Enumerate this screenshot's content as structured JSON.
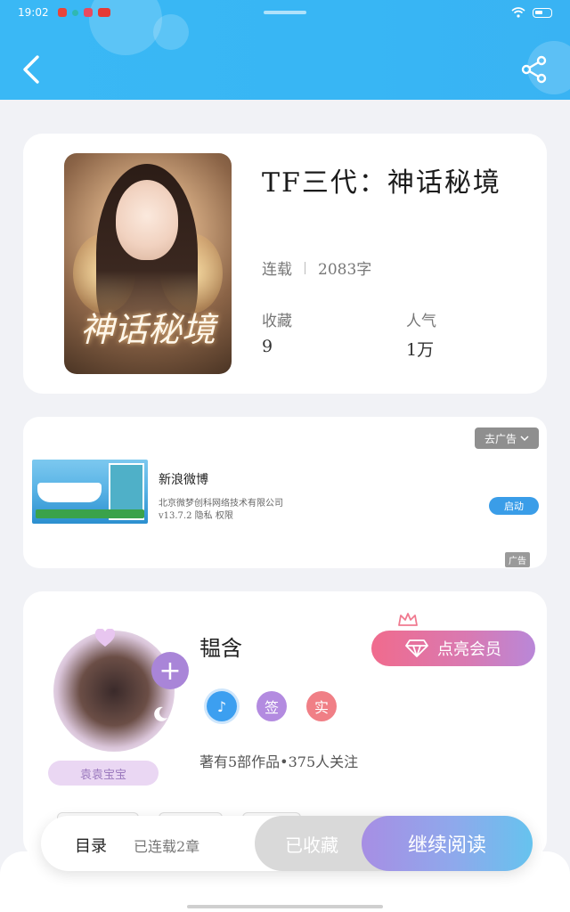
{
  "status_bar": {
    "time": "19:02"
  },
  "header": {
    "back_icon": "chevron-left-icon",
    "share_icon": "share-icon"
  },
  "book": {
    "title": "TF三代：神话秘境",
    "cover_title": "神话秘境",
    "status": "连载",
    "word_count": "2083字",
    "stats": [
      {
        "label": "收藏",
        "value": "9"
      },
      {
        "label": "人气",
        "value": "1万"
      }
    ]
  },
  "ad": {
    "close_label": "去广告",
    "app_name": "新浪微博",
    "company": "北京微梦创科网络技术有限公司",
    "version": "v13.7.2  隐私  权限",
    "cta": "启动",
    "tag": "广告"
  },
  "author": {
    "name": "韫含",
    "badge_text": "袁袁宝宝",
    "vip_label": "点亮会员",
    "badges": [
      {
        "label": "♪",
        "color": "#3c9ff0"
      },
      {
        "label": "签",
        "color": "#b38be0"
      },
      {
        "label": "实",
        "color": "#f07f86"
      }
    ],
    "stats_text": "著有5部作品•375人关注"
  },
  "bottom_bar": {
    "toc_label": "目录",
    "chapter_label": "已连载2章",
    "collected_label": "已收藏",
    "read_label": "继续阅读"
  },
  "colors": {
    "accent_blue": "#38b6f4",
    "vip_pink": "#f06b8d"
  }
}
